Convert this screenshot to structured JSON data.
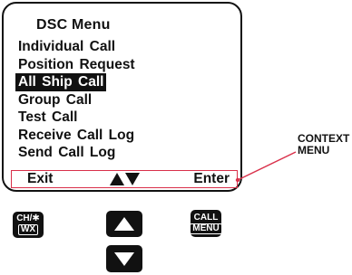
{
  "screen": {
    "title": "DSC Menu",
    "menu_items": [
      {
        "label": "Individual  Call"
      },
      {
        "label": "Position  Request"
      },
      {
        "label": "All Ship Call",
        "selected": true
      },
      {
        "label": "Group  Call"
      },
      {
        "label": "Test  Call"
      },
      {
        "label": "Receive  Call Log"
      },
      {
        "label": "Send  Call  Log"
      }
    ],
    "softkeys": {
      "left": "Exit",
      "center_icon": "up-down-arrows-icon",
      "right": "Enter"
    }
  },
  "callout": {
    "line1": "CONTEXT",
    "line2": "MENU",
    "color": "#d9304a"
  },
  "hardware_keys": {
    "chwx": {
      "line1": "CH/✱",
      "line2": "WX"
    },
    "up_icon": "up-arrow-icon",
    "call": {
      "line1": "CALL",
      "line2": "MENU"
    },
    "down_icon": "down-arrow-icon"
  }
}
